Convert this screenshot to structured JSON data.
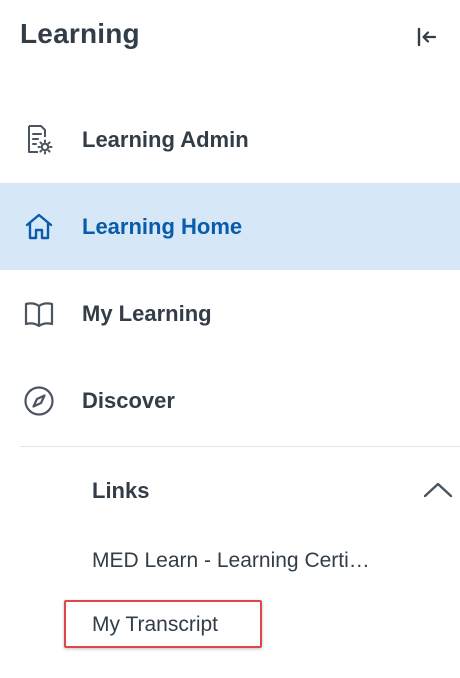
{
  "header": {
    "title": "Learning"
  },
  "nav": {
    "items": [
      {
        "label": "Learning Admin",
        "icon": "document-gear-icon",
        "active": false
      },
      {
        "label": "Learning Home",
        "icon": "home-icon",
        "active": true
      },
      {
        "label": "My Learning",
        "icon": "book-icon",
        "active": false
      },
      {
        "label": "Discover",
        "icon": "compass-icon",
        "active": false
      }
    ]
  },
  "links": {
    "label": "Links",
    "expanded": true,
    "items": [
      {
        "label": "MED Learn - Learning Certi…"
      },
      {
        "label": "My Transcript"
      }
    ]
  },
  "colors": {
    "active_bg": "#d6e8f8",
    "active_text": "#0a5ba8",
    "text": "#333d47",
    "icon": "#4a5561",
    "highlight": "#e0454c"
  }
}
